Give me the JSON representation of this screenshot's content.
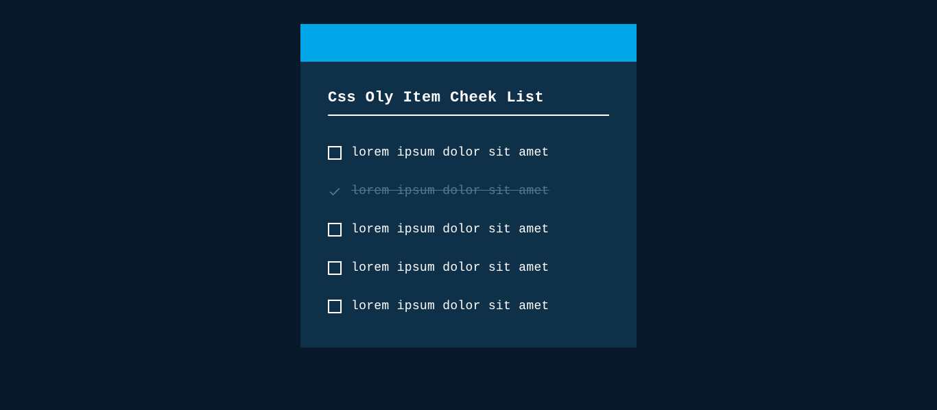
{
  "card": {
    "title": "Css Oly Item Cheek List",
    "items": [
      {
        "label": "lorem ipsum dolor sit amet",
        "checked": false
      },
      {
        "label": "lorem ipsum dolor sit amet",
        "checked": true
      },
      {
        "label": "lorem ipsum dolor sit amet",
        "checked": false
      },
      {
        "label": "lorem ipsum dolor sit amet",
        "checked": false
      },
      {
        "label": "lorem ipsum dolor sit amet",
        "checked": false
      }
    ]
  },
  "colors": {
    "background": "#0a1929",
    "cardBg": "#0f3049",
    "accent": "#00a6e8",
    "text": "#ffffff",
    "muted": "#4f7a94"
  }
}
